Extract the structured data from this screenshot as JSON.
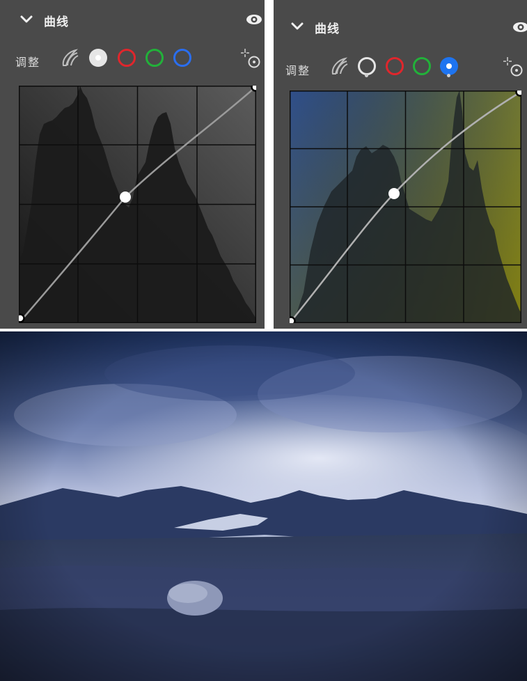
{
  "left_panel": {
    "title": "曲线",
    "adjust_label": "调整",
    "selected_channel": "luminance",
    "channels": [
      {
        "id": "luminance",
        "color": "#ffffff",
        "selected": true
      },
      {
        "id": "red",
        "color": "#e0262c",
        "selected": false
      },
      {
        "id": "green",
        "color": "#22b13a",
        "selected": false
      },
      {
        "id": "blue",
        "color": "#2a6ef0",
        "selected": false
      }
    ],
    "curve_points": [
      [
        0,
        0
      ],
      [
        0.45,
        0.53
      ],
      [
        1,
        1
      ]
    ]
  },
  "right_panel": {
    "title": "曲线",
    "adjust_label": "调整",
    "selected_channel": "blue",
    "channels": [
      {
        "id": "luminance",
        "color": "#ffffff",
        "selected": false
      },
      {
        "id": "red",
        "color": "#e0262c",
        "selected": false
      },
      {
        "id": "green",
        "color": "#22b13a",
        "selected": false
      },
      {
        "id": "blue",
        "color": "#1e74f0",
        "selected": true
      }
    ],
    "curve_points": [
      [
        0,
        0
      ],
      [
        0.45,
        0.56
      ],
      [
        1,
        1
      ]
    ]
  },
  "colors": {
    "panel_bg": "#4a4a4a",
    "graph_grid": "#111111",
    "histogram": "#1a1a1a"
  },
  "icons": [
    "chevron-down-icon",
    "eye-icon",
    "auto-adjust-icon",
    "eyedropper-target-icon"
  ]
}
